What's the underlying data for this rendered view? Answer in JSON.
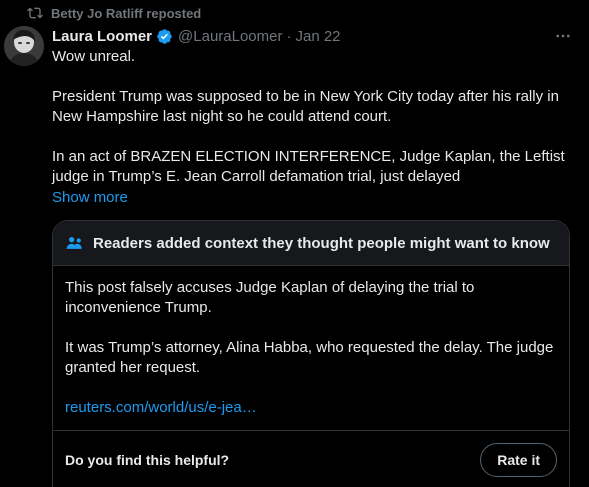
{
  "repost": {
    "text": "Betty Jo Ratliff reposted",
    "icon": "repost-icon"
  },
  "author": {
    "display_name": "Laura Loomer",
    "handle": "@LauraLoomer",
    "separator": "·",
    "date": "Jan 22",
    "verified_color": "#1d9bf0"
  },
  "post": {
    "paragraphs": [
      "Wow unreal.",
      "President Trump was supposed to be in New York City today after his rally in New Hampshire last night so he could attend court.",
      "In an act of BRAZEN ELECTION INTERFERENCE, Judge Kaplan, the Leftist judge in Trump’s E. Jean Carroll defamation trial, just delayed"
    ],
    "show_more": "Show more"
  },
  "note": {
    "header": "Readers added context they thought people might want to know",
    "paragraphs": [
      "This post falsely accuses Judge Kaplan of delaying the trial to inconvenience Trump.",
      "It was Trump’s attorney, Alina Habba, who requested the delay. The judge granted her request."
    ],
    "link": "reuters.com/world/us/e-jea…",
    "helpful_question": "Do you find this helpful?",
    "rate_button": "Rate it"
  },
  "colors": {
    "background": "#000000",
    "text": "#e7e9ea",
    "muted": "#71767b",
    "link": "#1d9bf0",
    "border": "#2f3336"
  }
}
